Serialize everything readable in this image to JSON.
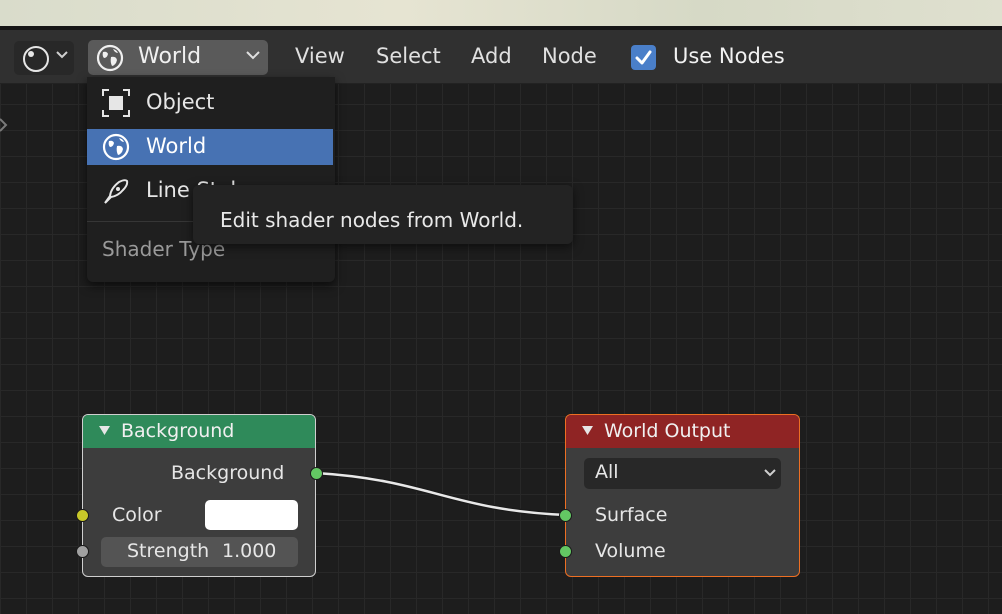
{
  "header": {
    "shader_type_selected": "World",
    "menus": [
      "View",
      "Select",
      "Add",
      "Node"
    ],
    "use_nodes_label": "Use Nodes",
    "use_nodes_checked": true
  },
  "dropdown": {
    "items": [
      {
        "label": "Object",
        "icon": "object-icon",
        "active": false
      },
      {
        "label": "World",
        "icon": "world-icon",
        "active": true
      },
      {
        "label": "Line Style",
        "icon": "line-style-icon",
        "active": false
      }
    ],
    "heading": "Shader Type"
  },
  "tooltip": {
    "text": "Edit shader nodes from World."
  },
  "nodes": {
    "background": {
      "title": "Background",
      "output_label": "Background",
      "color_label": "Color",
      "color_value": "#ffffff",
      "strength_label": "Strength",
      "strength_value": "1.000",
      "header_color": "#2f8a5a"
    },
    "world_output": {
      "title": "World Output",
      "target": "All",
      "surface_label": "Surface",
      "volume_label": "Volume",
      "header_color": "#8f2424"
    }
  },
  "colors": {
    "accent": "#4772b3",
    "checkbox": "#4a7fc9",
    "socket_shader": "#63c763",
    "socket_color": "#c7c729",
    "socket_float": "#a1a1a1",
    "node_active_border": "#ed6f23"
  }
}
